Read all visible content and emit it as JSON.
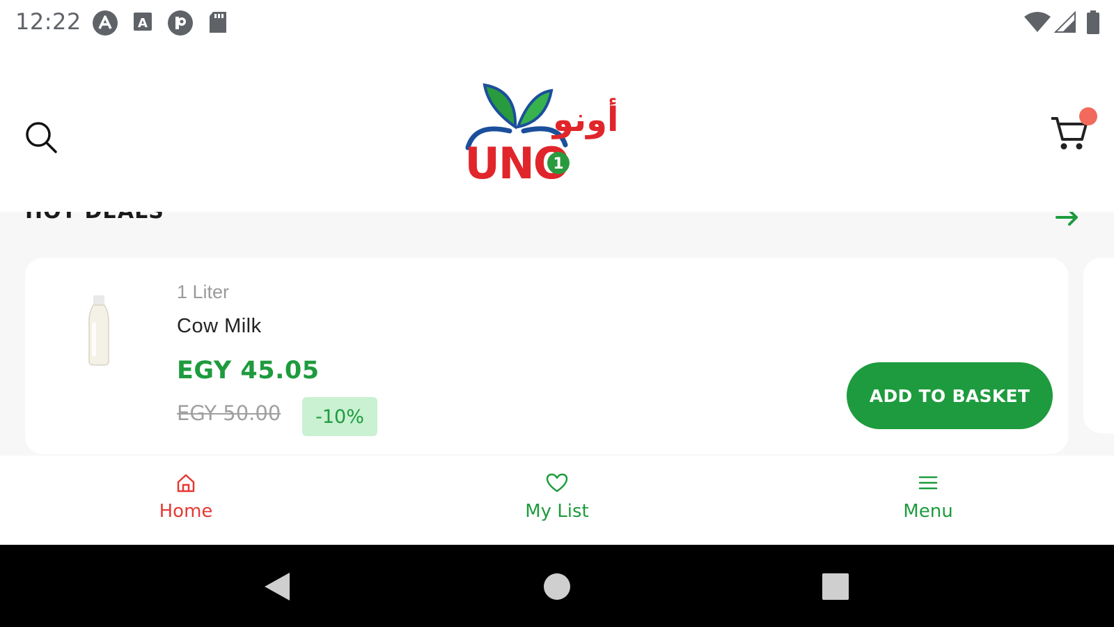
{
  "status_bar": {
    "time": "12:22",
    "left_icons": [
      "app-a-icon",
      "app-letter-icon",
      "app-p-icon",
      "sd-card-icon"
    ],
    "right_icons": [
      "wifi-icon",
      "cellular-signal-icon",
      "battery-icon"
    ]
  },
  "header": {
    "logo_text": "UNO",
    "logo_arabic": "أونو",
    "cart_badge_color": "#f26a5b"
  },
  "hot_deals": {
    "title": "HOT DEALS",
    "product": {
      "unit": "1 Liter",
      "name": "Cow Milk",
      "price": "EGY 45.05",
      "old_price": "EGY 50.00",
      "discount": "-10%",
      "add_button_label": "ADD TO BASKET"
    }
  },
  "bottom_nav": {
    "items": [
      {
        "label": "Home",
        "icon": "home-icon",
        "active": true
      },
      {
        "label": "My List",
        "icon": "heart-icon",
        "active": false
      },
      {
        "label": "Menu",
        "icon": "menu-icon",
        "active": false
      }
    ]
  },
  "colors": {
    "accent_green": "#1e9b3e",
    "active_red": "#e53935",
    "discount_bg": "#c9f1d2"
  }
}
